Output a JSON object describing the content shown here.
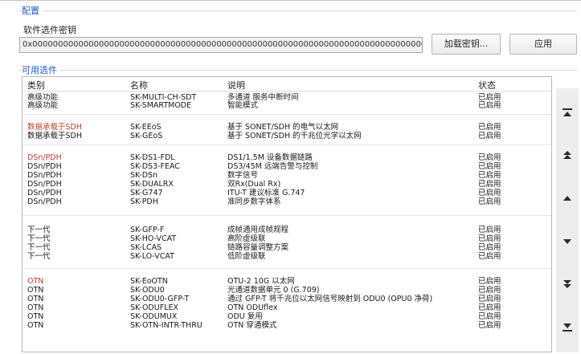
{
  "config": {
    "section_title": "配置",
    "key_label": "软件选件密钥",
    "key_value": "0x0000000000000000000000000000000000000000000000000000000000000000000000000000000000000",
    "load_key_button": "加载密钥...",
    "apply_button": "应用"
  },
  "options": {
    "section_title": "可用选件",
    "headers": [
      "类别",
      "名称",
      "说明",
      "状态"
    ],
    "rows": [
      {
        "category": "高级功能",
        "name": "SK-MULTI-CH-SDT",
        "desc": "多通道 服务中断时间",
        "status": "已启用",
        "red": false
      },
      {
        "category": "高级功能",
        "name": "SK-SMARTMODE",
        "desc": "智能模式",
        "status": "已启用",
        "red": false
      },
      {
        "category": "数据承载于SDH",
        "name": "SK-EEoS",
        "desc": "基于 SONET/SDH 的电气以太网",
        "status": "已启用",
        "red": true
      },
      {
        "category": "数据承载于SDH",
        "name": "SK-GEoS",
        "desc": "基于 SONET/SDH 的千兆位光学以太网",
        "status": "已启用",
        "red": false
      },
      {
        "category": "DSn/PDH",
        "name": "SK-DS1-FDL",
        "desc": "DS1/1.5M 设备数据链路",
        "status": "已启用",
        "red": true
      },
      {
        "category": "DSn/PDH",
        "name": "SK-DS3-FEAC",
        "desc": "DS3/45M 远端告警与控制",
        "status": "已启用",
        "red": false
      },
      {
        "category": "DSn/PDH",
        "name": "SK-DSn",
        "desc": "数字信号",
        "status": "已启用",
        "red": false
      },
      {
        "category": "DSn/PDH",
        "name": "SK-DUALRX",
        "desc": "双Rx(Dual Rx)",
        "status": "已启用",
        "red": false
      },
      {
        "category": "DSn/PDH",
        "name": "SK-G747",
        "desc": "ITU-T 建议标准 G.747",
        "status": "已启用",
        "red": false
      },
      {
        "category": "DSn/PDH",
        "name": "SK-PDH",
        "desc": "准同步数字体系",
        "status": "已启用",
        "red": false
      },
      {
        "category": "下一代",
        "name": "SK-GFP-F",
        "desc": "成帧通用成帧规程",
        "status": "已启用",
        "red": false
      },
      {
        "category": "下一代",
        "name": "SK-HO-VCAT",
        "desc": "高阶虚级联",
        "status": "已启用",
        "red": false
      },
      {
        "category": "下一代",
        "name": "SK-LCAS",
        "desc": "链路容量调整方案",
        "status": "已启用",
        "red": false
      },
      {
        "category": "下一代",
        "name": "SK-LO-VCAT",
        "desc": "低阶虚级联",
        "status": "已启用",
        "red": false
      },
      {
        "category": "OTN",
        "name": "SK-EoOTN",
        "desc": "OTU-2 10G 以太网",
        "status": "已启用",
        "red": true
      },
      {
        "category": "OTN",
        "name": "SK-ODU0",
        "desc": "光通道数据单元 0 (G.709)",
        "status": "已启用",
        "red": false
      },
      {
        "category": "OTN",
        "name": "SK-ODU0-GFP-T",
        "desc": "通过 GFP-T 将千兆位以太网信号映射到 ODU0 (OPU0 净荷)",
        "status": "已启用",
        "red": false
      },
      {
        "category": "OTN",
        "name": "SK-ODUFLEX",
        "desc": "OTN ODUflex",
        "status": "已启用",
        "red": false
      },
      {
        "category": "OTN",
        "name": "SK-ODUMUX",
        "desc": "ODU 复用",
        "status": "已启用",
        "red": false
      },
      {
        "category": "OTN",
        "name": "SK-OTN-INTR-THRU",
        "desc": "OTN 穿通模式",
        "status": "已启用",
        "red": false
      }
    ]
  },
  "nav": {
    "buttons": [
      {
        "icon": "scroll-to-top-icon"
      },
      {
        "icon": "page-up-icon"
      },
      {
        "icon": "row-up-icon"
      },
      {
        "icon": "row-down-icon"
      },
      {
        "icon": "page-down-icon"
      },
      {
        "icon": "scroll-to-bottom-icon"
      }
    ]
  },
  "colors": {
    "accent_title": "#1f5fbf",
    "category_red": "#b4442a",
    "icon_dark": "#2b2b2b"
  }
}
